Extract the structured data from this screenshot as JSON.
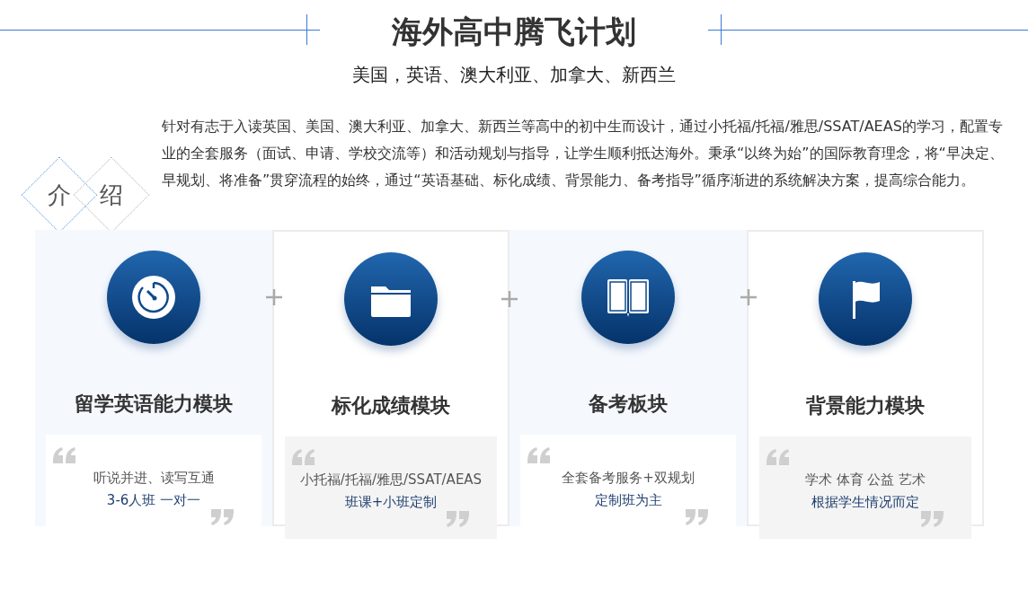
{
  "header": {
    "title": "海外高中腾飞计划",
    "subtitle": "美国，英语、澳大利亚、加拿大、新西兰"
  },
  "intro": {
    "label_chars": [
      "介",
      "绍"
    ],
    "text": "针对有志于入读英国、美国、澳大利亚、加拿大、新西兰等高中的初中生而设计，通过小托福/托福/雅思/SSAT/AEAS的学习，配置专业的全套服务（面试、申请、学校交流等）和活动规划与指导，让学生顺利抵达海外。秉承“以终为始”的国际教育理念，将“早决定、早规划、将准备”贯穿流程的始终，通过“英语基础、标化成绩、背景能力、备考指导”循序渐进的系统解决方案，提高综合能力。"
  },
  "modules": [
    {
      "kind": "tinted",
      "title": "留学英语能力模块",
      "line_1": "听说并进、读写互通",
      "line_2": "3-6人班 一对一"
    },
    {
      "kind": "bordered",
      "title": "标化成绩模块",
      "line_1": "小托福/托福/雅思/SSAT/AEAS",
      "line_2": "班课+小班定制"
    },
    {
      "kind": "tinted",
      "title": "备考板块",
      "line_1": "全套备考服务+双规划",
      "line_2": "定制班为主"
    },
    {
      "kind": "bordered",
      "title": "背景能力模块",
      "line_1": "学术 体育 公益 艺术",
      "line_2": "根据学生情况而定"
    }
  ]
}
